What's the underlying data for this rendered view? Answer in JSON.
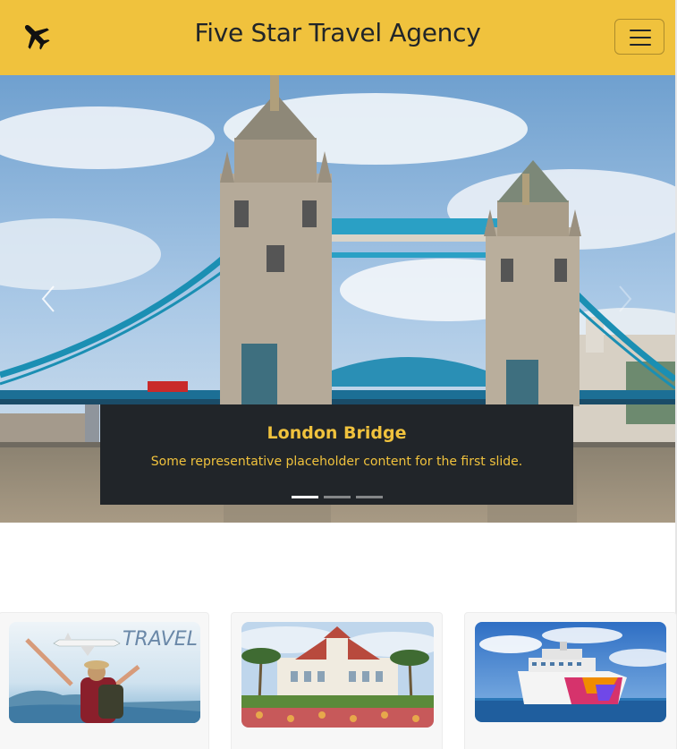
{
  "navbar": {
    "brand_icon": "airplane-icon",
    "title": "Five Star Travel Agency",
    "toggler_icon": "hamburger-menu-icon"
  },
  "carousel": {
    "slides": [
      {
        "title": "London Bridge",
        "text": "Some representative placeholder content for the first slide.",
        "image": "tower-bridge-photo"
      }
    ],
    "active_index": 0,
    "indicator_count": 3,
    "prev_icon": "chevron-left-icon",
    "next_icon": "chevron-right-icon"
  },
  "cards": [
    {
      "image": "traveler-with-airplane-photo",
      "overlay_text": "TRAVEL"
    },
    {
      "image": "resort-hotel-photo"
    },
    {
      "image": "cruise-ship-photo"
    }
  ],
  "colors": {
    "accent": "#f0c23d",
    "caption_bg": "#212529",
    "text_dark": "#212529"
  }
}
